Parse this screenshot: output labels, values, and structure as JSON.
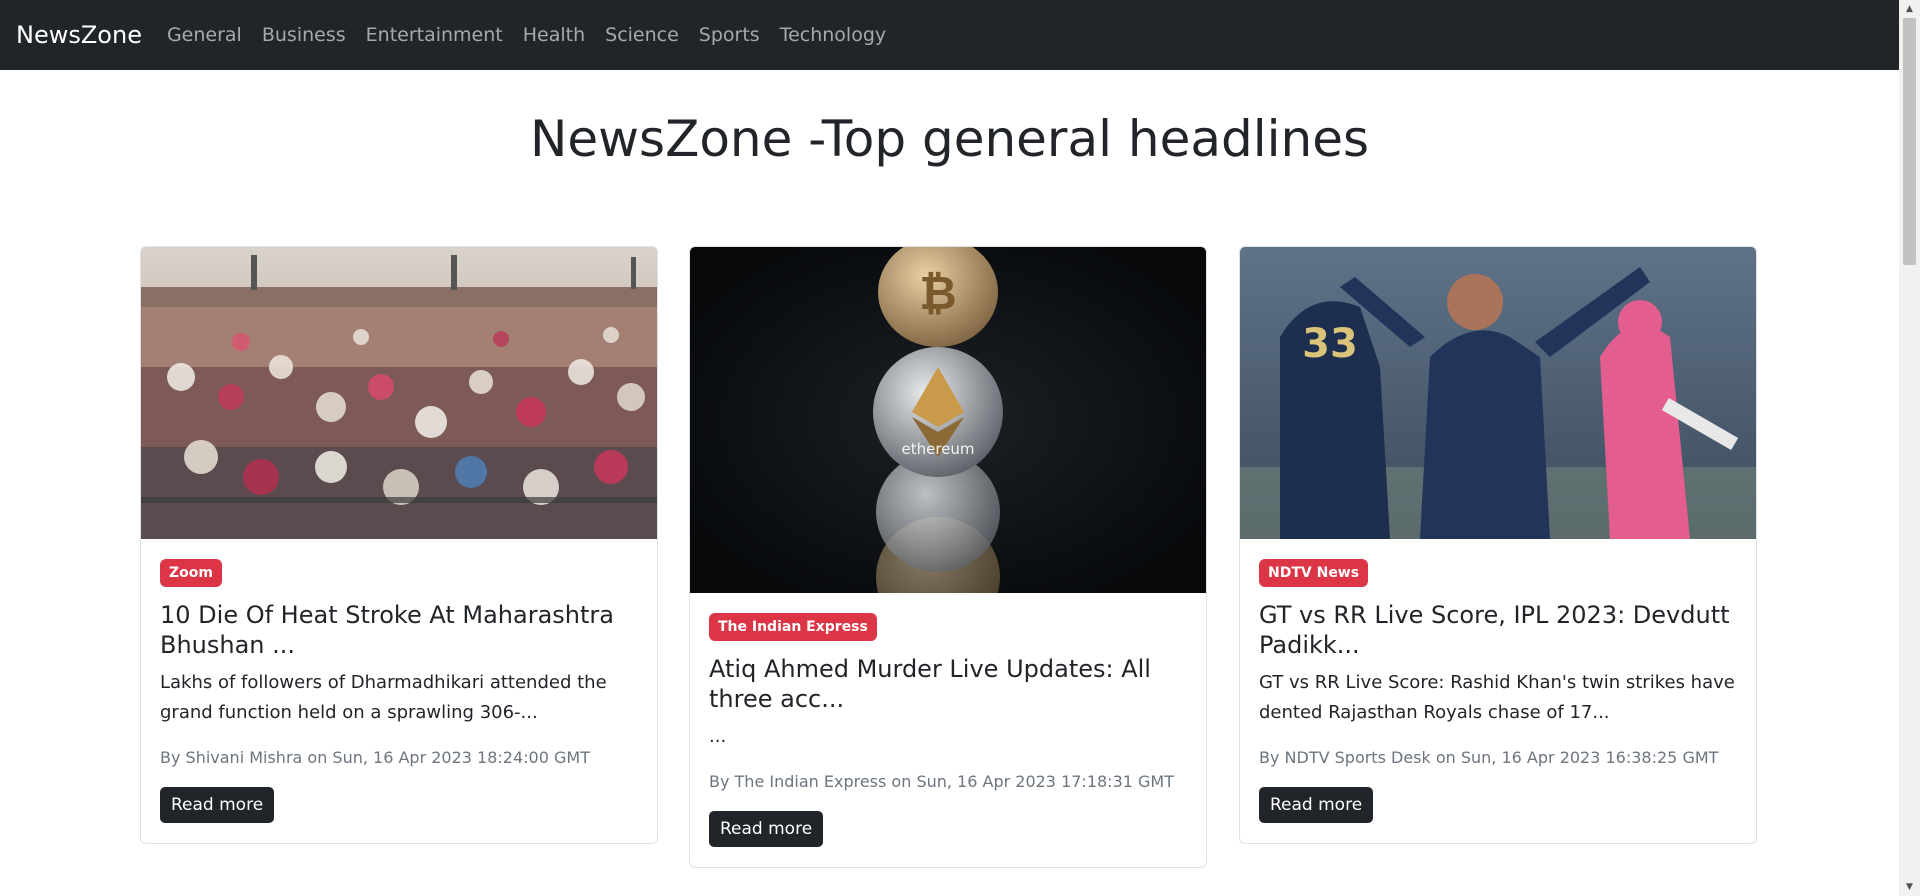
{
  "nav": {
    "brand": "NewsZone",
    "links": [
      "General",
      "Business",
      "Entertainment",
      "Health",
      "Science",
      "Sports",
      "Technology"
    ]
  },
  "page": {
    "title": "NewsZone -Top general headlines"
  },
  "articles": [
    {
      "source": "Zoom",
      "title": "10 Die Of Heat Stroke At Maharashtra Bhushan ...",
      "description": "Lakhs of followers of Dharmadhikari attended the grand function held on a sprawling 306-...",
      "meta": "By Shivani Mishra on Sun, 16 Apr 2023 18:24:00 GMT",
      "cta": "Read more"
    },
    {
      "source": "The Indian Express",
      "title": "Atiq Ahmed Murder Live Updates: All three acc...",
      "description": "...",
      "meta": "By The Indian Express on Sun, 16 Apr 2023 17:18:31 GMT",
      "cta": "Read more",
      "image_text": "ethereum"
    },
    {
      "source": "NDTV News",
      "title": "GT vs RR Live Score, IPL 2023: Devdutt Padikk...",
      "description": "GT vs RR Live Score: Rashid Khan's twin strikes have dented Rajasthan Royals chase of 17...",
      "meta": "By NDTV Sports Desk on Sun, 16 Apr 2023 16:38:25 GMT",
      "cta": "Read more",
      "image_text": "33"
    }
  ],
  "colors": {
    "navbar": "#212529",
    "badge": "#dc3545",
    "button": "#212529",
    "meta": "#6c757d"
  }
}
